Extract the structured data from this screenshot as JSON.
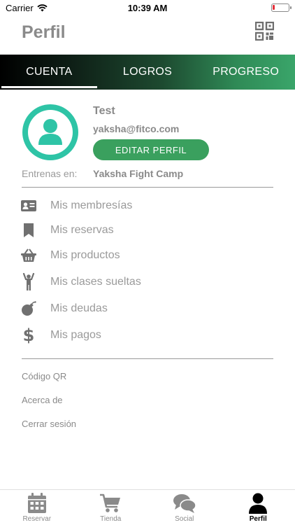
{
  "status_bar": {
    "carrier": "Carrier",
    "time": "10:39 AM"
  },
  "header": {
    "title": "Perfil"
  },
  "tabs": [
    {
      "label": "CUENTA",
      "active": true
    },
    {
      "label": "LOGROS",
      "active": false
    },
    {
      "label": "PROGRESO",
      "active": false
    }
  ],
  "profile": {
    "name": "Test",
    "email": "yaksha@fitco.com",
    "edit_button": "EDITAR PERFIL",
    "train_label": "Entrenas en:",
    "train_value": "Yaksha Fight Camp"
  },
  "menu": [
    {
      "label": "Mis membresías",
      "icon": "id-card-icon"
    },
    {
      "label": "Mis reservas",
      "icon": "bookmark-icon"
    },
    {
      "label": "Mis productos",
      "icon": "basket-icon"
    },
    {
      "label": "Mis clases sueltas",
      "icon": "person-lifting-icon"
    },
    {
      "label": "Mis deudas",
      "icon": "bomb-icon"
    },
    {
      "label": "Mis pagos",
      "icon": "dollar-icon"
    }
  ],
  "links": [
    {
      "label": "Código QR"
    },
    {
      "label": "Acerca de"
    },
    {
      "label": "Cerrar sesión"
    }
  ],
  "bottom_nav": [
    {
      "label": "Reservar",
      "icon": "calendar-icon",
      "active": false
    },
    {
      "label": "Tienda",
      "icon": "cart-icon",
      "active": false
    },
    {
      "label": "Social",
      "icon": "chat-bubbles-icon",
      "active": false
    },
    {
      "label": "Perfil",
      "icon": "user-icon",
      "active": true
    }
  ],
  "colors": {
    "accent": "#3aa05e",
    "avatar_ring": "#2ec4a6",
    "battery_low": "#e5303a"
  }
}
